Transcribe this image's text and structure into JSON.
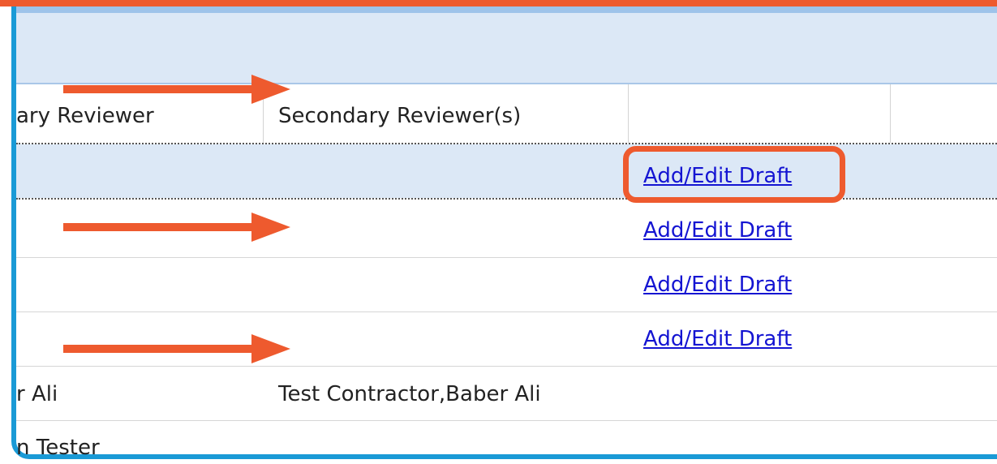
{
  "grid": {
    "columns": [
      {
        "label": "ary Reviewer"
      },
      {
        "label": "Secondary Reviewer(s)"
      },
      {
        "label": ""
      },
      {
        "label": ""
      }
    ],
    "rows": [
      {
        "primary": "",
        "secondary": "",
        "action": "Add/Edit Draft"
      },
      {
        "primary": "",
        "secondary": "",
        "action": "Add/Edit Draft"
      },
      {
        "primary": "",
        "secondary": "",
        "action": "Add/Edit Draft"
      },
      {
        "primary": "",
        "secondary": "",
        "action": "Add/Edit Draft"
      },
      {
        "primary": "r Ali",
        "secondary": "Test Contractor,Baber Ali",
        "action": ""
      },
      {
        "primary": "n Tester",
        "secondary": "",
        "action": ""
      }
    ]
  },
  "annotations": {
    "accent_color": "#ee5a2e",
    "frame_color": "#1a9ad6",
    "arrows": [
      "arrow-right",
      "arrow-right",
      "arrow-right"
    ]
  }
}
